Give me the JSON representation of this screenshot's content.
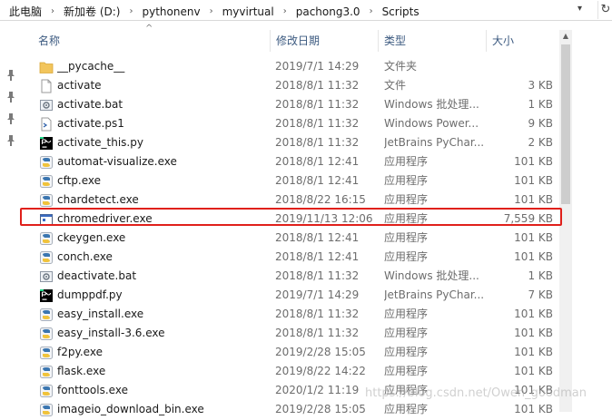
{
  "breadcrumb": [
    "此电脑",
    "新加卷 (D:)",
    "pythonenv",
    "myvirtual",
    "pachong3.0",
    "Scripts"
  ],
  "columns": {
    "name": "名称",
    "date": "修改日期",
    "type": "类型",
    "size": "大小"
  },
  "files": [
    {
      "name": "__pycache__",
      "date": "2019/7/1 14:29",
      "type": "文件夹",
      "size": "",
      "icon": "folder-icon"
    },
    {
      "name": "activate",
      "date": "2018/8/1 11:32",
      "type": "文件",
      "size": "3 KB",
      "icon": "file-icon"
    },
    {
      "name": "activate.bat",
      "date": "2018/8/1 11:32",
      "type": "Windows 批处理...",
      "size": "1 KB",
      "icon": "batch-file-icon"
    },
    {
      "name": "activate.ps1",
      "date": "2018/8/1 11:32",
      "type": "Windows Power...",
      "size": "9 KB",
      "icon": "powershell-file-icon"
    },
    {
      "name": "activate_this.py",
      "date": "2018/8/1 11:32",
      "type": "JetBrains PyChar...",
      "size": "2 KB",
      "icon": "pycharm-file-icon"
    },
    {
      "name": "automat-visualize.exe",
      "date": "2018/8/1 12:41",
      "type": "应用程序",
      "size": "101 KB",
      "icon": "python-exe-icon"
    },
    {
      "name": "cftp.exe",
      "date": "2018/8/1 12:41",
      "type": "应用程序",
      "size": "101 KB",
      "icon": "python-exe-icon"
    },
    {
      "name": "chardetect.exe",
      "date": "2018/8/22 16:15",
      "type": "应用程序",
      "size": "101 KB",
      "icon": "python-exe-icon"
    },
    {
      "name": "chromedriver.exe",
      "date": "2019/11/13 12:06",
      "type": "应用程序",
      "size": "7,559 KB",
      "icon": "exe-window-icon"
    },
    {
      "name": "ckeygen.exe",
      "date": "2018/8/1 12:41",
      "type": "应用程序",
      "size": "101 KB",
      "icon": "python-exe-icon"
    },
    {
      "name": "conch.exe",
      "date": "2018/8/1 12:41",
      "type": "应用程序",
      "size": "101 KB",
      "icon": "python-exe-icon"
    },
    {
      "name": "deactivate.bat",
      "date": "2018/8/1 11:32",
      "type": "Windows 批处理...",
      "size": "1 KB",
      "icon": "batch-file-icon"
    },
    {
      "name": "dumppdf.py",
      "date": "2019/7/1 14:29",
      "type": "JetBrains PyChar...",
      "size": "7 KB",
      "icon": "pycharm-file-icon"
    },
    {
      "name": "easy_install.exe",
      "date": "2018/8/1 11:32",
      "type": "应用程序",
      "size": "101 KB",
      "icon": "python-exe-icon"
    },
    {
      "name": "easy_install-3.6.exe",
      "date": "2018/8/1 11:32",
      "type": "应用程序",
      "size": "101 KB",
      "icon": "python-exe-icon"
    },
    {
      "name": "f2py.exe",
      "date": "2019/2/28 15:05",
      "type": "应用程序",
      "size": "101 KB",
      "icon": "python-exe-icon"
    },
    {
      "name": "flask.exe",
      "date": "2019/8/22 14:22",
      "type": "应用程序",
      "size": "101 KB",
      "icon": "python-exe-icon"
    },
    {
      "name": "fonttools.exe",
      "date": "2020/1/2 11:19",
      "type": "应用程序",
      "size": "101 KB",
      "icon": "python-exe-icon"
    },
    {
      "name": "imageio_download_bin.exe",
      "date": "2019/2/28 15:05",
      "type": "应用程序",
      "size": "101 KB",
      "icon": "python-exe-icon"
    }
  ],
  "watermark": "https://blog.csdn.net/Owen_goodman",
  "colors": {
    "highlight": "#e0201b",
    "header_text": "#3c5a80",
    "folder": "#f2c55c"
  }
}
